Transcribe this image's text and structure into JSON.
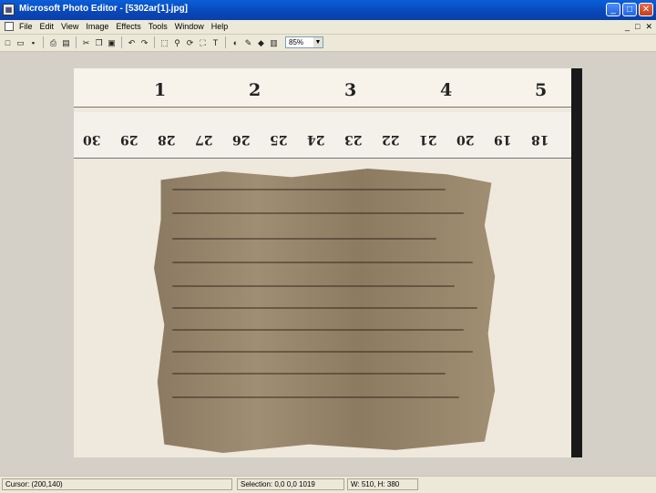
{
  "window": {
    "title": "Microsoft Photo Editor - [5302ar[1].jpg]",
    "minimize": "_",
    "maximize": "□",
    "close": "✕"
  },
  "menu": {
    "items": [
      "File",
      "Edit",
      "View",
      "Image",
      "Effects",
      "Tools",
      "Window",
      "Help"
    ],
    "doc_minimize": "_",
    "doc_restore": "□",
    "doc_close": "✕"
  },
  "toolbar": {
    "zoom_value": "85%"
  },
  "image": {
    "inch_marks": [
      "1",
      "2",
      "3",
      "4",
      "5"
    ],
    "cm_marks": [
      "30",
      "29",
      "28",
      "27",
      "26",
      "25",
      "24",
      "23",
      "22",
      "21",
      "20",
      "19",
      "18"
    ]
  },
  "status": {
    "cursor": "Cursor: (200,140)",
    "selection": "Selection: 0,0 0,0 1019",
    "size": "W: 510, H: 380"
  }
}
